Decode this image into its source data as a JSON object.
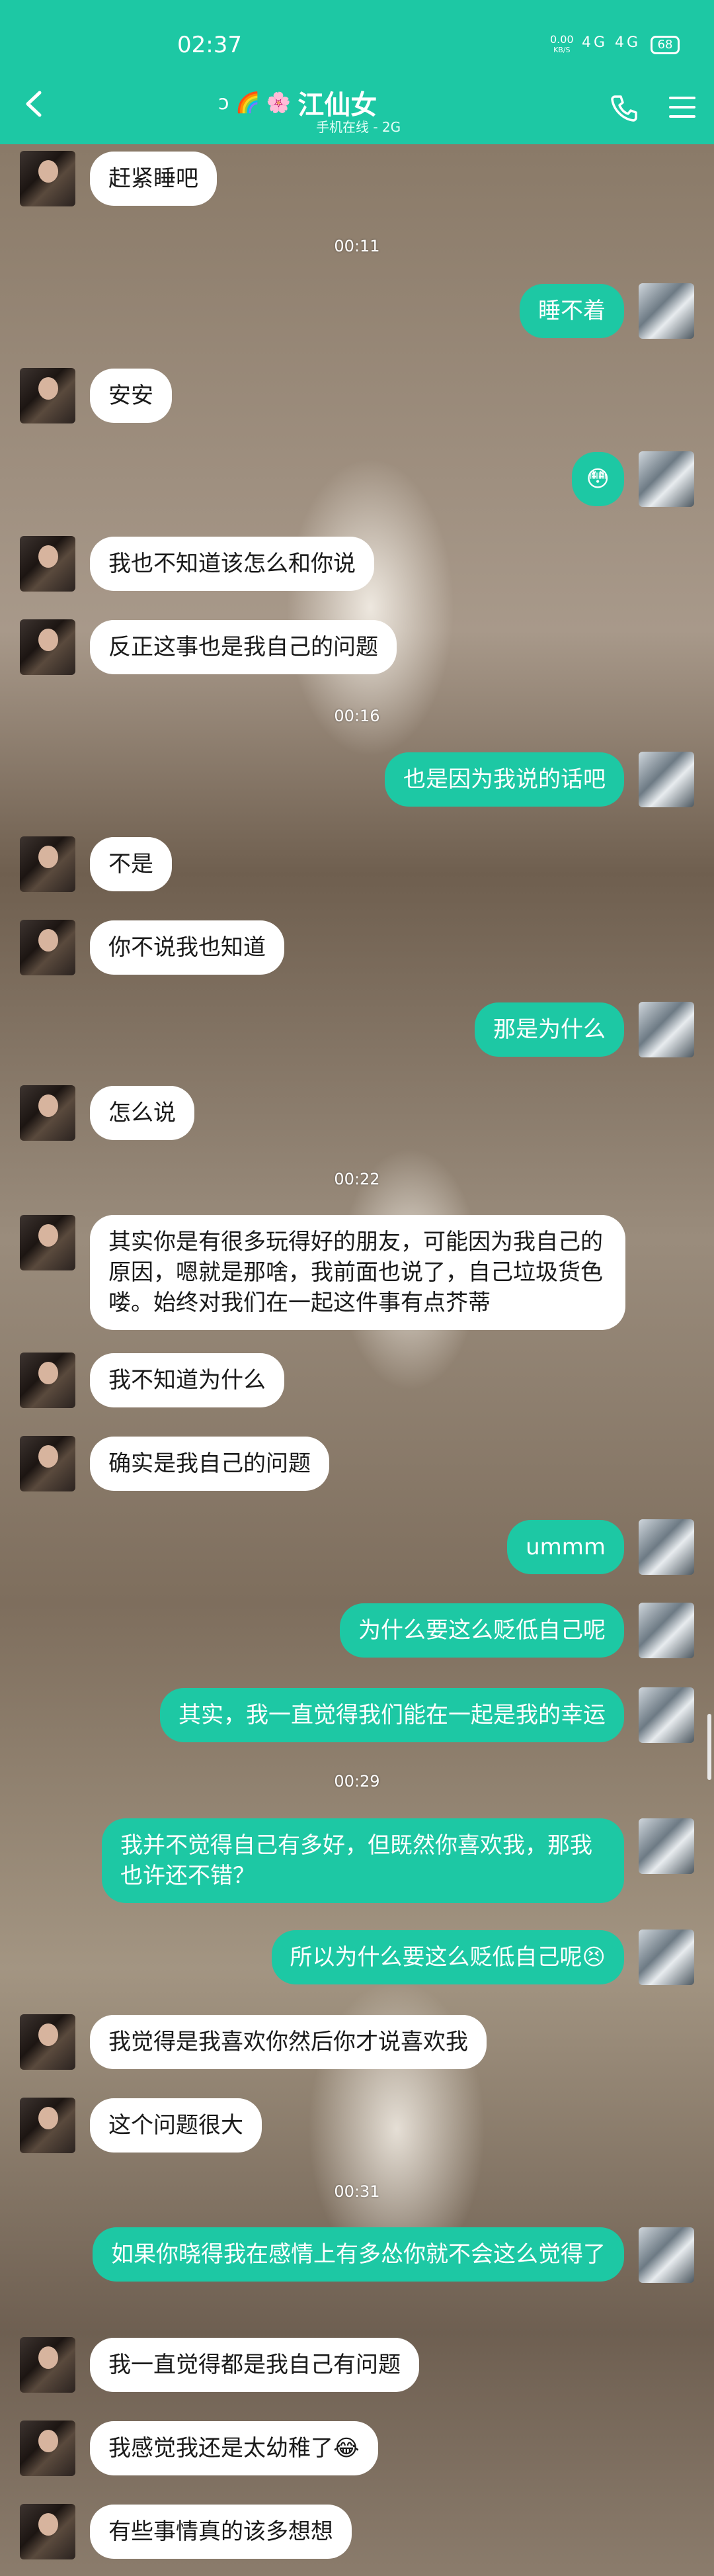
{
  "status_bar": {
    "time": "02:37",
    "net_speed": "0.00",
    "net_unit": "KB/S",
    "signal": "4G 4G",
    "battery": "68"
  },
  "header": {
    "title": "江仙女",
    "subtitle": "手机在线 - 2G",
    "title_icons": "ↄ 🌈 🌸"
  },
  "colors": {
    "accent": "#1dc8a4",
    "incoming_bubble": "#ffffff",
    "outgoing_bubble": "#1dc8a4"
  },
  "timestamps": [
    "00:11",
    "00:16",
    "00:22",
    "00:29",
    "00:31"
  ],
  "messages": [
    {
      "dir": "in",
      "text": "赶紧睡吧"
    },
    {
      "dir": "out",
      "text": "睡不着"
    },
    {
      "dir": "in",
      "text": "安安"
    },
    {
      "dir": "out",
      "text": "😳"
    },
    {
      "dir": "in",
      "text": "我也不知道该怎么和你说"
    },
    {
      "dir": "in",
      "text": "反正这事也是我自己的问题"
    },
    {
      "dir": "out",
      "text": "也是因为我说的话吧"
    },
    {
      "dir": "in",
      "text": "不是"
    },
    {
      "dir": "in",
      "text": "你不说我也知道"
    },
    {
      "dir": "out",
      "text": "那是为什么"
    },
    {
      "dir": "in",
      "text": "怎么说"
    },
    {
      "dir": "in",
      "text": "其实你是有很多玩得好的朋友，可能因为我自己的原因，嗯就是那啥，我前面也说了，自己垃圾货色喽。始终对我们在一起这件事有点芥蒂"
    },
    {
      "dir": "in",
      "text": "我不知道为什么"
    },
    {
      "dir": "in",
      "text": "确实是我自己的问题"
    },
    {
      "dir": "out",
      "text": "ummm"
    },
    {
      "dir": "out",
      "text": "为什么要这么贬低自己呢"
    },
    {
      "dir": "out",
      "text": "其实，我一直觉得我们能在一起是我的幸运"
    },
    {
      "dir": "out",
      "text": "我并不觉得自己有多好，但既然你喜欢我，那我也许还不错？"
    },
    {
      "dir": "out",
      "text": "所以为什么要这么贬低自己呢😣"
    },
    {
      "dir": "in",
      "text": "我觉得是我喜欢你然后你才说喜欢我"
    },
    {
      "dir": "in",
      "text": "这个问题很大"
    },
    {
      "dir": "out",
      "text": "如果你晓得我在感情上有多怂你就不会这么觉得了"
    },
    {
      "dir": "in",
      "text": "我一直觉得都是我自己有问题"
    },
    {
      "dir": "in",
      "text": "我感觉我还是太幼稚了😂"
    },
    {
      "dir": "in",
      "text": "有些事情真的该多想想"
    }
  ]
}
